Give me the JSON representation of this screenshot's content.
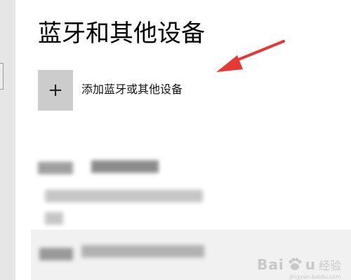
{
  "page": {
    "title": "蓝牙和其他设备"
  },
  "add_device": {
    "icon": "plus-icon",
    "label": "添加蓝牙或其他设备"
  },
  "annotation": {
    "icon": "red-arrow-icon",
    "color": "#e53935"
  },
  "watermark": {
    "brand": "Bai",
    "brand_suffix": "u",
    "cn": "经验",
    "sub": "jingyan.baidu.com"
  }
}
